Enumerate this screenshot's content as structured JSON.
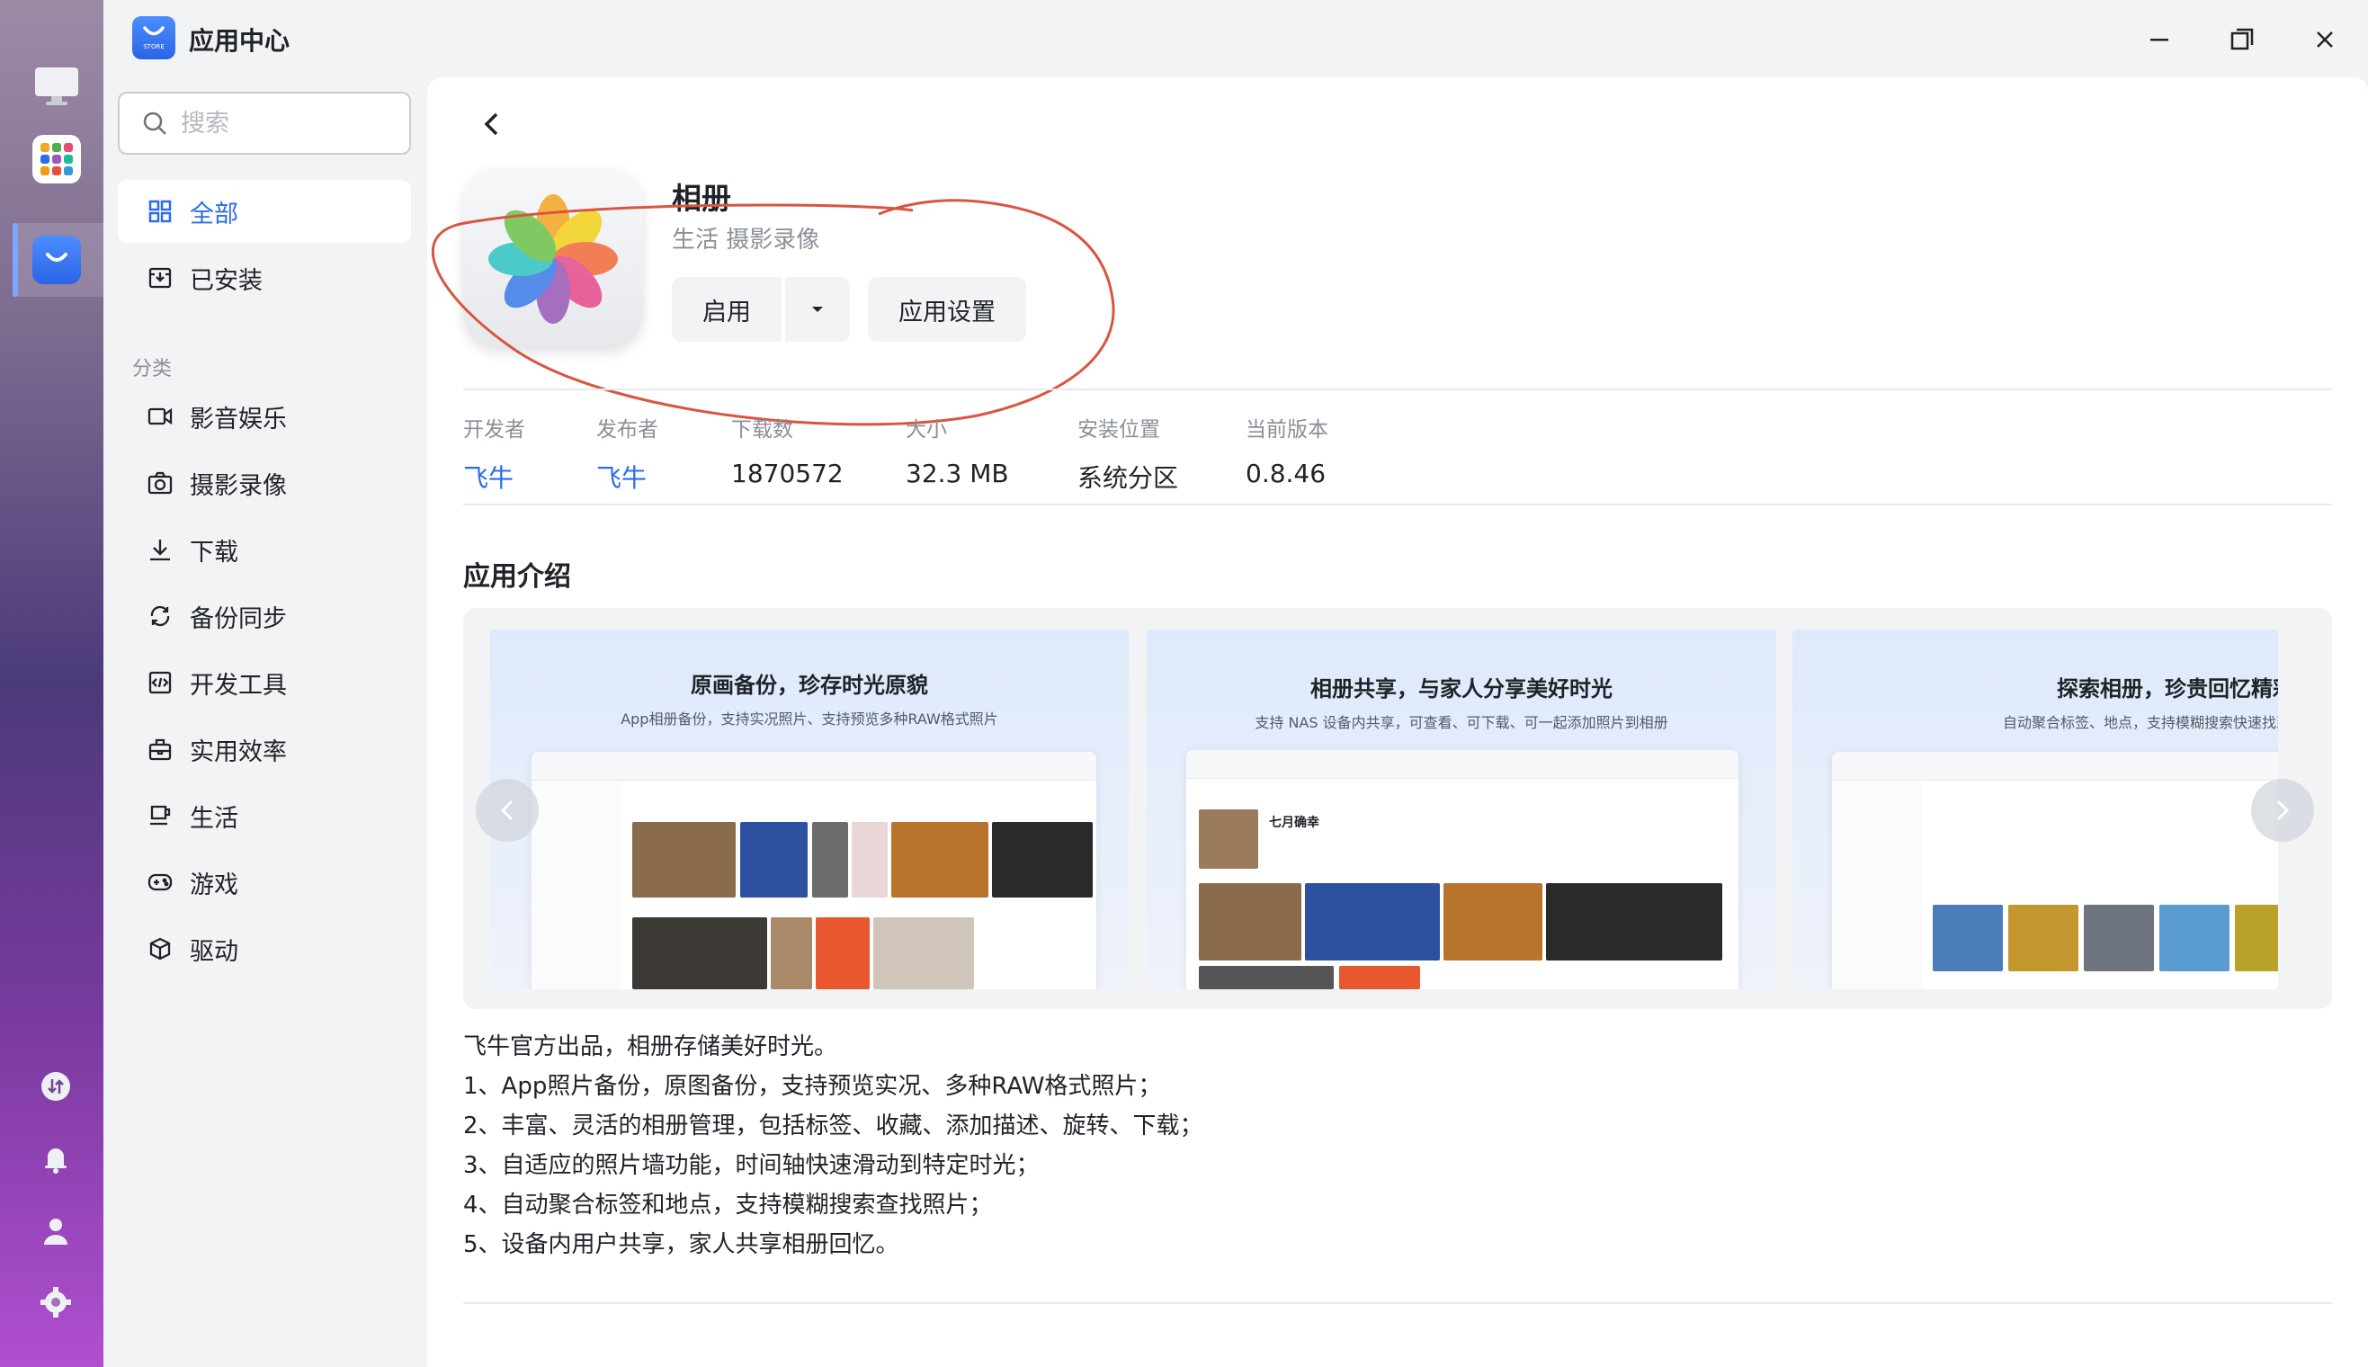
{
  "window": {
    "title": "应用中心",
    "icon_label": "STORE"
  },
  "search": {
    "placeholder": "搜索"
  },
  "nav": {
    "primary": [
      {
        "label": "全部",
        "active": true
      },
      {
        "label": "已安装",
        "active": false
      }
    ],
    "category_title": "分类",
    "categories": [
      {
        "label": "影音娱乐"
      },
      {
        "label": "摄影录像"
      },
      {
        "label": "下载"
      },
      {
        "label": "备份同步"
      },
      {
        "label": "开发工具"
      },
      {
        "label": "实用效率"
      },
      {
        "label": "生活"
      },
      {
        "label": "游戏"
      },
      {
        "label": "驱动"
      }
    ]
  },
  "app": {
    "name": "相册",
    "categories": "生活 摄影录像",
    "start_label": "启用",
    "settings_label": "应用设置"
  },
  "meta": [
    {
      "key": "开发者",
      "value": "飞牛",
      "link": true
    },
    {
      "key": "发布者",
      "value": "飞牛",
      "link": true
    },
    {
      "key": "下载数",
      "value": "1870572",
      "link": false
    },
    {
      "key": "大小",
      "value": "32.3 MB",
      "link": false
    },
    {
      "key": "安装位置",
      "value": "系统分区",
      "link": false
    },
    {
      "key": "当前版本",
      "value": "0.8.46",
      "link": false
    }
  ],
  "intro": {
    "title": "应用介绍",
    "screenshots": [
      {
        "title": "原画备份，珍存时光原貌",
        "subtitle": "App相册备份，支持实况照片、支持预览多种RAW格式照片"
      },
      {
        "title": "相册共享，与家人分享美好时光",
        "subtitle": "支持 NAS 设备内共享，可查看、可下载、可一起添加照片到相册",
        "album_name": "七月确幸"
      },
      {
        "title": "探索相册，珍贵回忆精彩纷呈",
        "subtitle": "自动聚合标签、地点，支持模糊搜索快速找到珍藏的回忆相册"
      }
    ],
    "description": [
      "飞牛官方出品，相册存储美好时光。",
      "1、App照片备份，原图备份，支持预览实况、多种RAW格式照片；",
      "2、丰富、灵活的相册管理，包括标签、收藏、添加描述、旋转、下载；",
      "3、自适应的照片墙功能，时间轴快速滑动到特定时光；",
      "4、自动聚合标签和地点，支持模糊搜索查找照片；",
      "5、设备内用户共享，家人共享相册回忆。"
    ]
  },
  "colors": {
    "accent": "#2b6de8",
    "annotation": "#d9553f"
  }
}
